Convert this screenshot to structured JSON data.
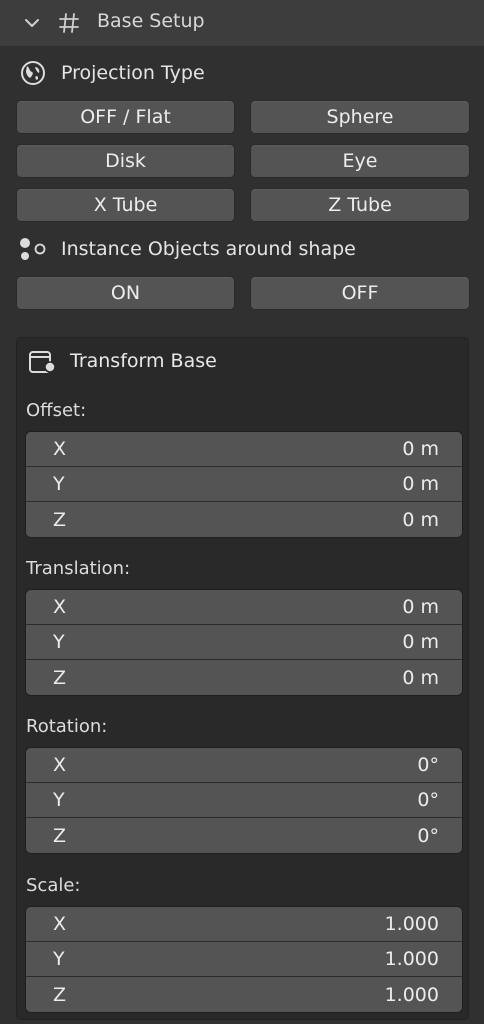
{
  "panel": {
    "title": "Base Setup",
    "chevron_icon": "chevron-down-icon",
    "header_icon": "grid-hash-icon"
  },
  "projection": {
    "label": "Projection Type",
    "icon": "globe-icon",
    "buttons": [
      "OFF / Flat",
      "Sphere",
      "Disk",
      "Eye",
      "X Tube",
      "Z Tube"
    ]
  },
  "instance": {
    "label": "Instance Objects around shape",
    "icon": "particles-icon",
    "buttons": [
      "ON",
      "OFF"
    ]
  },
  "transform": {
    "title": "Transform Base",
    "icon": "transform-icon",
    "offset": {
      "label": "Offset:",
      "rows": [
        {
          "axis": "X",
          "value": "0 m"
        },
        {
          "axis": "Y",
          "value": "0 m"
        },
        {
          "axis": "Z",
          "value": "0 m"
        }
      ]
    },
    "translation": {
      "label": "Translation:",
      "rows": [
        {
          "axis": "X",
          "value": "0 m"
        },
        {
          "axis": "Y",
          "value": "0 m"
        },
        {
          "axis": "Z",
          "value": "0 m"
        }
      ]
    },
    "rotation": {
      "label": "Rotation:",
      "rows": [
        {
          "axis": "X",
          "value": "0°"
        },
        {
          "axis": "Y",
          "value": "0°"
        },
        {
          "axis": "Z",
          "value": "0°"
        }
      ]
    },
    "scale": {
      "label": "Scale:",
      "rows": [
        {
          "axis": "X",
          "value": "1.000"
        },
        {
          "axis": "Y",
          "value": "1.000"
        },
        {
          "axis": "Z",
          "value": "1.000"
        }
      ]
    }
  },
  "colors": {
    "background": "#303030",
    "header": "#3d3d3d",
    "button": "#545454",
    "subpanel": "#292929"
  }
}
